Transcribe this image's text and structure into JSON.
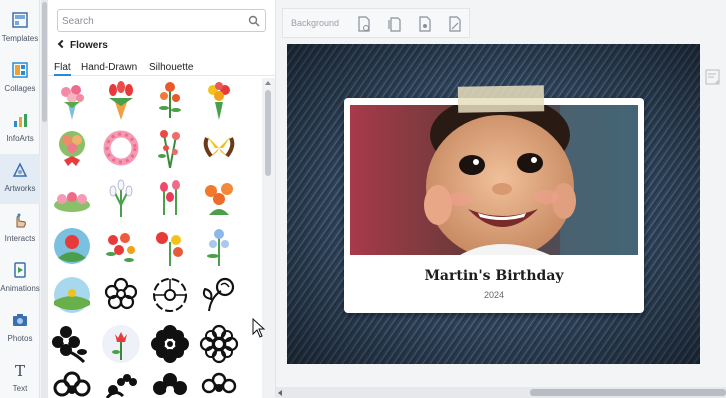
{
  "rail": {
    "items": [
      {
        "label": "Templates",
        "icon": "templates-icon"
      },
      {
        "label": "Collages",
        "icon": "collages-icon"
      },
      {
        "label": "InfoArts",
        "icon": "infoarts-icon"
      },
      {
        "label": "Artworks",
        "icon": "artworks-icon",
        "active": true
      },
      {
        "label": "Interacts",
        "icon": "interacts-icon"
      },
      {
        "label": "Animations",
        "icon": "animations-icon"
      },
      {
        "label": "Photos",
        "icon": "photos-icon"
      },
      {
        "label": "Text",
        "icon": "text-icon"
      }
    ]
  },
  "panel": {
    "search_placeholder": "Search",
    "category": "Flowers",
    "tabs": [
      "Flat",
      "Hand-Drawn",
      "Silhouette"
    ],
    "active_tab": "Flat"
  },
  "toolbar": {
    "background_label": "Background"
  },
  "card": {
    "title": "Martin's Birthday",
    "year": "2024"
  },
  "colors": {
    "accent": "#2a8ad4",
    "denim": "#2f4257"
  }
}
